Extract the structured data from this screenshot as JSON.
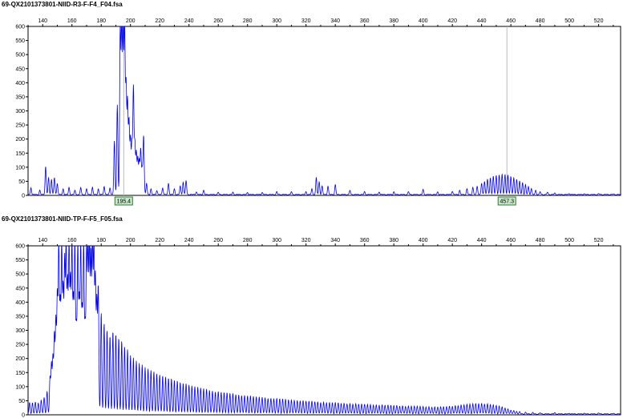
{
  "colors": {
    "trace": "#0000ee",
    "axis": "#000000",
    "marker_border": "#2e7d32",
    "marker_fill": "#c8e6c9",
    "marker_line": "#bbbbbb"
  },
  "chart_data": [
    {
      "type": "line",
      "title": "69-QX2101373801-NIID-R3-F-F4_F04.fsa",
      "xlim": [
        130,
        535
      ],
      "ylim": [
        0,
        600
      ],
      "x_ticks": [
        140,
        160,
        180,
        200,
        220,
        240,
        260,
        280,
        300,
        320,
        340,
        360,
        380,
        400,
        420,
        440,
        460,
        480,
        500,
        520
      ],
      "y_ticks": [
        0,
        50,
        100,
        150,
        200,
        250,
        300,
        350,
        400,
        450,
        500,
        550,
        600
      ],
      "grid": false,
      "markers": [
        {
          "label": "195.4",
          "x": 195.4
        },
        {
          "label": "457.3",
          "x": 457.3
        }
      ],
      "peaks": [
        [
          132,
          25
        ],
        [
          138,
          15
        ],
        [
          142,
          100
        ],
        [
          144,
          60
        ],
        [
          146,
          55
        ],
        [
          148,
          60
        ],
        [
          150,
          40
        ],
        [
          154,
          20
        ],
        [
          158,
          25
        ],
        [
          162,
          15
        ],
        [
          166,
          25
        ],
        [
          170,
          20
        ],
        [
          174,
          25
        ],
        [
          178,
          20
        ],
        [
          182,
          30
        ],
        [
          186,
          25
        ],
        [
          189,
          190
        ],
        [
          191,
          320
        ],
        [
          193,
          600
        ],
        [
          194,
          600
        ],
        [
          195,
          600
        ],
        [
          196,
          600
        ],
        [
          197,
          390
        ],
        [
          198,
          330
        ],
        [
          199,
          260
        ],
        [
          200,
          200
        ],
        [
          201,
          180
        ],
        [
          202,
          380
        ],
        [
          203,
          180
        ],
        [
          204,
          150
        ],
        [
          205,
          130
        ],
        [
          206,
          120
        ],
        [
          207,
          160
        ],
        [
          208,
          90
        ],
        [
          209,
          210
        ],
        [
          211,
          40
        ],
        [
          214,
          20
        ],
        [
          218,
          15
        ],
        [
          222,
          25
        ],
        [
          226,
          40
        ],
        [
          230,
          20
        ],
        [
          234,
          30
        ],
        [
          236,
          45
        ],
        [
          238,
          50
        ],
        [
          245,
          10
        ],
        [
          250,
          15
        ],
        [
          260,
          8
        ],
        [
          270,
          8
        ],
        [
          280,
          8
        ],
        [
          290,
          8
        ],
        [
          300,
          10
        ],
        [
          310,
          10
        ],
        [
          320,
          10
        ],
        [
          324,
          20
        ],
        [
          327,
          60
        ],
        [
          329,
          45
        ],
        [
          331,
          30
        ],
        [
          335,
          30
        ],
        [
          340,
          35
        ],
        [
          350,
          15
        ],
        [
          360,
          10
        ],
        [
          370,
          10
        ],
        [
          380,
          10
        ],
        [
          390,
          10
        ],
        [
          400,
          18
        ],
        [
          410,
          10
        ],
        [
          420,
          12
        ],
        [
          425,
          15
        ],
        [
          430,
          20
        ],
        [
          434,
          25
        ],
        [
          437,
          30
        ],
        [
          440,
          40
        ],
        [
          442,
          48
        ],
        [
          444,
          55
        ],
        [
          446,
          60
        ],
        [
          448,
          65
        ],
        [
          450,
          68
        ],
        [
          452,
          70
        ],
        [
          454,
          72
        ],
        [
          456,
          72
        ],
        [
          458,
          70
        ],
        [
          460,
          66
        ],
        [
          462,
          60
        ],
        [
          464,
          55
        ],
        [
          466,
          48
        ],
        [
          468,
          42
        ],
        [
          470,
          35
        ],
        [
          472,
          28
        ],
        [
          474,
          22
        ],
        [
          477,
          15
        ],
        [
          480,
          10
        ],
        [
          485,
          8
        ],
        [
          490,
          5
        ],
        [
          500,
          4
        ],
        [
          510,
          3
        ],
        [
          520,
          3
        ],
        [
          530,
          2
        ]
      ]
    },
    {
      "type": "line",
      "title": "69-QX2101373801-NIID-TP-F-F5_F05.fsa",
      "xlim": [
        130,
        535
      ],
      "ylim": [
        0,
        600
      ],
      "x_ticks": [
        140,
        160,
        180,
        200,
        220,
        240,
        260,
        280,
        300,
        320,
        340,
        360,
        380,
        400,
        420,
        440,
        460,
        480,
        500,
        520
      ],
      "y_ticks": [
        0,
        50,
        100,
        150,
        200,
        250,
        300,
        350,
        400,
        450,
        500,
        550,
        600
      ],
      "grid": false,
      "markers": [],
      "peaks": [
        [
          131,
          40
        ],
        [
          133,
          40
        ],
        [
          135,
          42
        ],
        [
          137,
          40
        ],
        [
          139,
          50
        ],
        [
          141,
          60
        ],
        [
          143,
          80
        ],
        [
          145,
          130
        ],
        [
          146,
          180
        ],
        [
          147,
          200
        ],
        [
          148,
          280
        ],
        [
          149,
          330
        ],
        [
          150,
          420
        ],
        [
          151,
          600
        ],
        [
          152,
          390
        ],
        [
          153,
          600
        ],
        [
          154,
          440
        ],
        [
          155,
          540
        ],
        [
          156,
          600
        ],
        [
          157,
          460
        ],
        [
          158,
          600
        ],
        [
          159,
          470
        ],
        [
          160,
          600
        ],
        [
          161,
          400
        ],
        [
          162,
          600
        ],
        [
          163,
          300
        ],
        [
          164,
          600
        ],
        [
          165,
          400
        ],
        [
          166,
          600
        ],
        [
          167,
          360
        ],
        [
          168,
          600
        ],
        [
          169,
          310
        ],
        [
          170,
          600
        ],
        [
          171,
          590
        ],
        [
          172,
          600
        ],
        [
          173,
          560
        ],
        [
          174,
          600
        ],
        [
          175,
          600
        ],
        [
          176,
          480
        ],
        [
          177,
          400
        ],
        [
          178,
          450
        ],
        [
          180,
          360
        ],
        [
          182,
          325
        ],
        [
          184,
          300
        ],
        [
          186,
          280
        ],
        [
          188,
          295
        ],
        [
          190,
          285
        ],
        [
          192,
          270
        ],
        [
          194,
          260
        ],
        [
          196,
          240
        ],
        [
          198,
          230
        ],
        [
          200,
          210
        ],
        [
          202,
          200
        ],
        [
          204,
          190
        ],
        [
          206,
          180
        ],
        [
          208,
          175
        ],
        [
          210,
          165
        ],
        [
          212,
          160
        ],
        [
          214,
          155
        ],
        [
          216,
          150
        ],
        [
          218,
          145
        ],
        [
          220,
          140
        ],
        [
          222,
          138
        ],
        [
          224,
          132
        ],
        [
          226,
          128
        ],
        [
          228,
          125
        ],
        [
          230,
          120
        ],
        [
          232,
          118
        ],
        [
          234,
          112
        ],
        [
          236,
          110
        ],
        [
          238,
          108
        ],
        [
          240,
          105
        ],
        [
          242,
          100
        ],
        [
          244,
          98
        ],
        [
          246,
          95
        ],
        [
          248,
          92
        ],
        [
          250,
          90
        ],
        [
          252,
          88
        ],
        [
          254,
          85
        ],
        [
          256,
          82
        ],
        [
          258,
          80
        ],
        [
          260,
          80
        ],
        [
          262,
          78
        ],
        [
          264,
          76
        ],
        [
          266,
          75
        ],
        [
          268,
          73
        ],
        [
          270,
          72
        ],
        [
          272,
          70
        ],
        [
          274,
          68
        ],
        [
          276,
          67
        ],
        [
          278,
          66
        ],
        [
          280,
          65
        ],
        [
          282,
          64
        ],
        [
          284,
          62
        ],
        [
          286,
          61
        ],
        [
          288,
          60
        ],
        [
          290,
          60
        ],
        [
          292,
          58
        ],
        [
          294,
          57
        ],
        [
          296,
          56
        ],
        [
          298,
          55
        ],
        [
          300,
          55
        ],
        [
          302,
          54
        ],
        [
          304,
          53
        ],
        [
          306,
          52
        ],
        [
          308,
          51
        ],
        [
          310,
          50
        ],
        [
          312,
          50
        ],
        [
          314,
          48
        ],
        [
          316,
          48
        ],
        [
          318,
          47
        ],
        [
          320,
          46
        ],
        [
          322,
          45
        ],
        [
          324,
          45
        ],
        [
          326,
          44
        ],
        [
          328,
          43
        ],
        [
          330,
          42
        ],
        [
          332,
          42
        ],
        [
          334,
          41
        ],
        [
          336,
          40
        ],
        [
          338,
          40
        ],
        [
          340,
          40
        ],
        [
          342,
          39
        ],
        [
          344,
          38
        ],
        [
          346,
          38
        ],
        [
          348,
          37
        ],
        [
          350,
          37
        ],
        [
          352,
          36
        ],
        [
          354,
          36
        ],
        [
          356,
          35
        ],
        [
          358,
          35
        ],
        [
          360,
          34
        ],
        [
          362,
          34
        ],
        [
          364,
          33
        ],
        [
          366,
          33
        ],
        [
          368,
          32
        ],
        [
          370,
          32
        ],
        [
          372,
          32
        ],
        [
          374,
          31
        ],
        [
          376,
          31
        ],
        [
          378,
          30
        ],
        [
          380,
          30
        ],
        [
          382,
          30
        ],
        [
          384,
          29
        ],
        [
          386,
          29
        ],
        [
          388,
          28
        ],
        [
          390,
          28
        ],
        [
          392,
          28
        ],
        [
          394,
          27
        ],
        [
          396,
          27
        ],
        [
          398,
          27
        ],
        [
          400,
          26
        ],
        [
          402,
          26
        ],
        [
          404,
          26
        ],
        [
          406,
          25
        ],
        [
          408,
          25
        ],
        [
          410,
          25
        ],
        [
          412,
          25
        ],
        [
          414,
          25
        ],
        [
          416,
          26
        ],
        [
          418,
          27
        ],
        [
          420,
          28
        ],
        [
          422,
          30
        ],
        [
          424,
          31
        ],
        [
          426,
          32
        ],
        [
          428,
          33
        ],
        [
          430,
          34
        ],
        [
          432,
          35
        ],
        [
          434,
          36
        ],
        [
          436,
          37
        ],
        [
          438,
          38
        ],
        [
          440,
          38
        ],
        [
          442,
          37
        ],
        [
          444,
          36
        ],
        [
          446,
          34
        ],
        [
          448,
          32
        ],
        [
          450,
          30
        ],
        [
          452,
          28
        ],
        [
          454,
          25
        ],
        [
          456,
          22
        ],
        [
          458,
          18
        ],
        [
          460,
          15
        ],
        [
          462,
          12
        ],
        [
          464,
          10
        ],
        [
          466,
          8
        ],
        [
          470,
          6
        ],
        [
          475,
          5
        ],
        [
          480,
          4
        ],
        [
          490,
          4
        ],
        [
          500,
          3
        ],
        [
          510,
          3
        ],
        [
          520,
          3
        ],
        [
          530,
          2
        ]
      ]
    }
  ]
}
